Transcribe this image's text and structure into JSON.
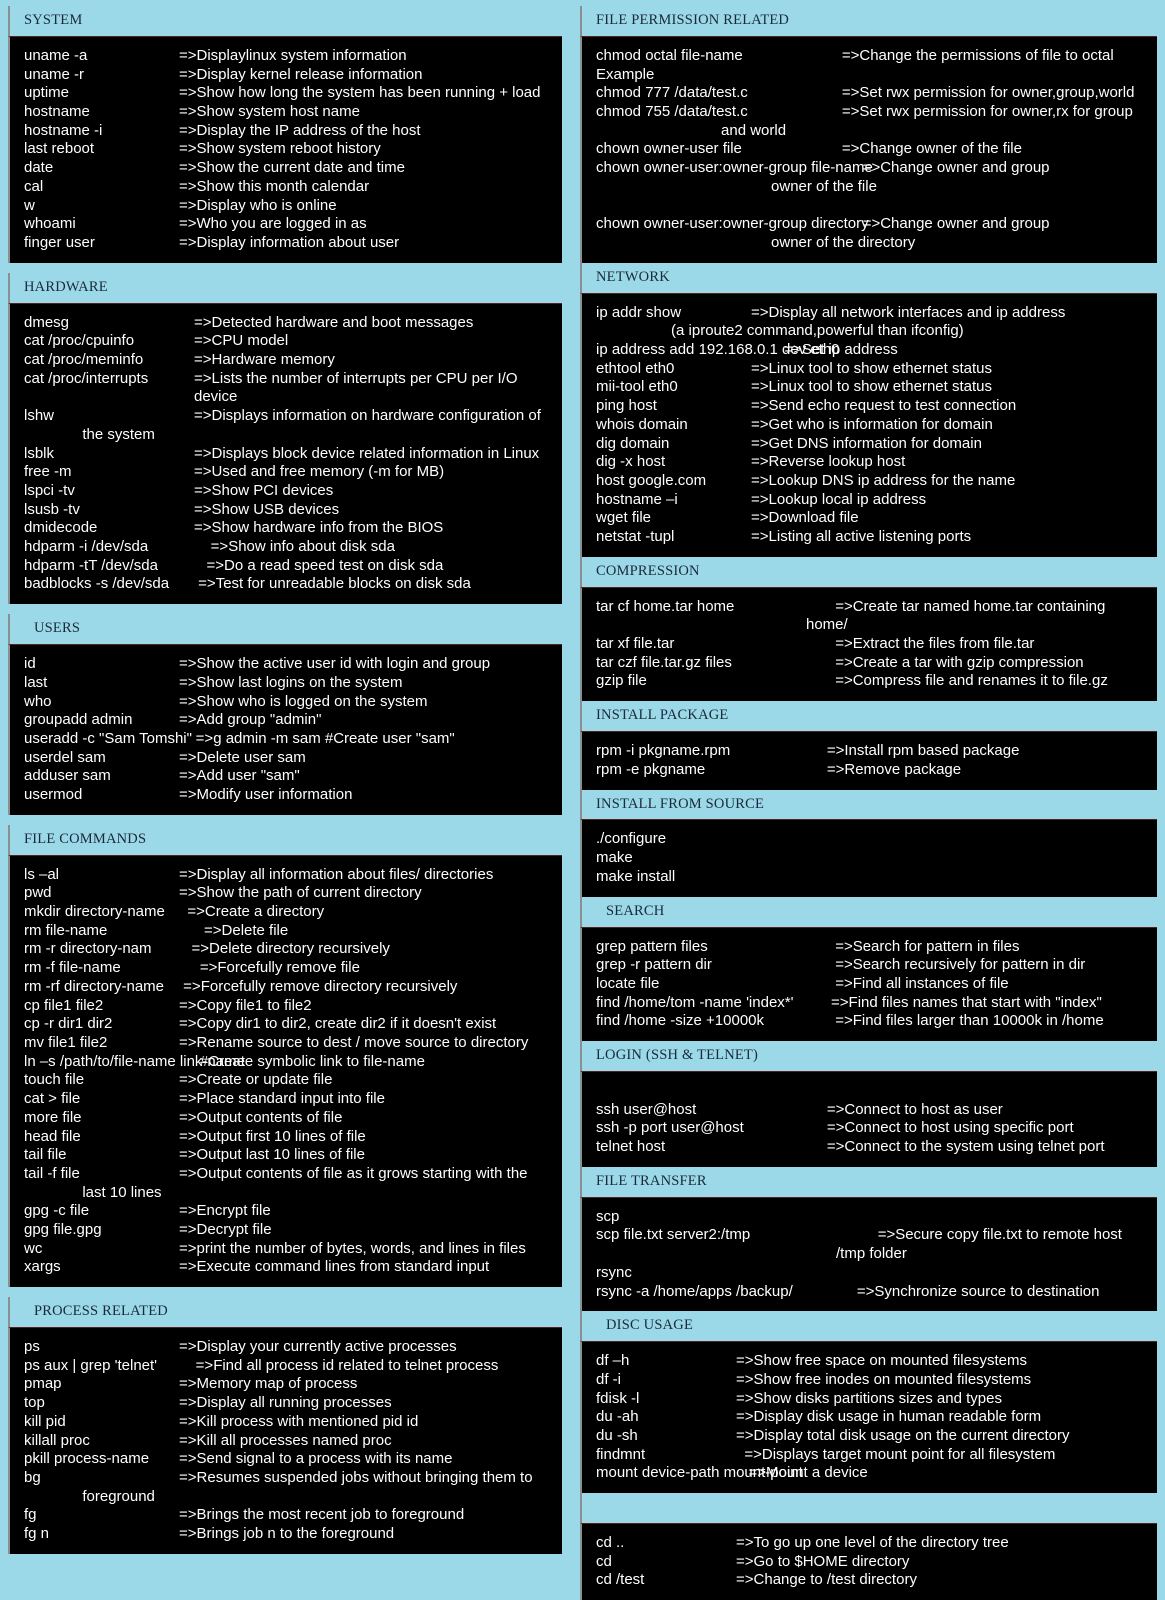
{
  "theme": {
    "background": "#9bd8e8",
    "panel": "#000000",
    "text": "#ffffff",
    "header_text": "#1b2a3a",
    "border": "#8a8f94"
  },
  "left_column": [
    {
      "title": "SYSTEM",
      "rows": [
        {
          "cmd": "uname -a",
          "desc": "=>Displaylinux system information"
        },
        {
          "cmd": "uname -r",
          "desc": "=>Display kernel release information"
        },
        {
          "cmd": "uptime",
          "desc": "=>Show how long the system has been running + load"
        },
        {
          "cmd": "hostname",
          "desc": "=>Show system host name"
        },
        {
          "cmd": "hostname -i",
          "desc": "=>Display the IP address of the host"
        },
        {
          "cmd": "last reboot",
          "desc": "=>Show system reboot history"
        },
        {
          "cmd": "date",
          "desc": "=>Show the current date and time"
        },
        {
          "cmd": "cal",
          "desc": "=>Show this month calendar"
        },
        {
          "cmd": "w",
          "desc": "=>Display who is online"
        },
        {
          "cmd": "whoami",
          "desc": "=>Who you are logged in as"
        },
        {
          "cmd": "finger user",
          "desc": "=>Display information about user"
        }
      ]
    },
    {
      "title": "HARDWARE",
      "rows": [
        {
          "cmd": "dmesg",
          "desc": "=>Detected hardware and boot messages"
        },
        {
          "cmd": "cat /proc/cpuinfo",
          "desc": "=>CPU model"
        },
        {
          "cmd": "cat /proc/meminfo",
          "desc": "=>Hardware memory"
        },
        {
          "cmd": "cat /proc/interrupts",
          "desc": "=>Lists the number of interrupts per CPU per I/O device"
        },
        {
          "cmd": "lshw",
          "desc": "=>Displays information on hardware configuration of"
        },
        {
          "cont": "              the system"
        },
        {
          "cmd": "lsblk",
          "desc": "=>Displays block device related information in Linux"
        },
        {
          "cmd": "free -m",
          "desc": "=>Used and free memory (-m for MB)"
        },
        {
          "cmd": "lspci -tv",
          "desc": "=>Show PCI devices"
        },
        {
          "cmd": "lsusb -tv",
          "desc": "=>Show USB devices"
        },
        {
          "cmd": "dmidecode",
          "desc": "=>Show hardware info from the BIOS"
        },
        {
          "cmd": "hdparm -i /dev/sda",
          "desc": "    =>Show info about disk sda"
        },
        {
          "cmd": "hdparm -tT /dev/sda",
          "desc": "   =>Do a read speed test on disk sda"
        },
        {
          "cmd": "badblocks -s /dev/sda",
          "desc": " =>Test for unreadable blocks on disk sda"
        }
      ]
    },
    {
      "title": "USERS",
      "indent": true,
      "rows": [
        {
          "cmd": "id",
          "desc": "=>Show the active user id with login and group"
        },
        {
          "cmd": "last",
          "desc": "=>Show last logins on the system"
        },
        {
          "cmd": "who",
          "desc": "=>Show who is logged on the system"
        },
        {
          "cmd": "groupadd admin",
          "desc": "=>Add group \"admin\""
        },
        {
          "cmd": "useradd -c \"Sam Tomshi\"",
          "desc": "    =>g admin -m sam #Create user \"sam\""
        },
        {
          "cmd": "userdel sam",
          "desc": "=>Delete user sam"
        },
        {
          "cmd": "adduser sam",
          "desc": "=>Add user \"sam\""
        },
        {
          "cmd": "usermod",
          "desc": "=>Modify user information"
        }
      ]
    },
    {
      "title": "FILE COMMANDS",
      "rows": [
        {
          "cmd": "ls –al",
          "desc": "=>Display all information about files/ directories"
        },
        {
          "cmd": "pwd",
          "desc": "=>Show the path of current directory"
        },
        {
          "cmd": "mkdir directory-name",
          "desc": "  =>Create a directory"
        },
        {
          "cmd": "rm file-name",
          "desc": "      =>Delete file"
        },
        {
          "cmd": "rm -r directory-nam",
          "desc": "   =>Delete directory recursively"
        },
        {
          "cmd": "rm -f file-name",
          "desc": "     =>Forcefully remove file"
        },
        {
          "cmd": "rm -rf directory-name",
          "desc": " =>Forcefully remove directory recursively"
        },
        {
          "cmd": "cp file1 file2",
          "desc": "=>Copy file1 to file2"
        },
        {
          "cmd": "cp -r dir1 dir2",
          "desc": "=>Copy dir1 to dir2, create dir2 if it doesn't exist"
        },
        {
          "cmd": "mv file1 file2",
          "desc": "=>Rename source to dest / move source to directory"
        },
        {
          "cmd": "ln –s /path/to/file-name link-name",
          "desc": "     #Create symbolic link to file-name"
        },
        {
          "cmd": "touch file",
          "desc": "=>Create or update file"
        },
        {
          "cmd": "cat > file",
          "desc": "=>Place standard input into file"
        },
        {
          "cmd": "more file",
          "desc": "=>Output contents of file"
        },
        {
          "cmd": "head file",
          "desc": "=>Output first 10 lines of file"
        },
        {
          "cmd": "tail file",
          "desc": "=>Output last 10 lines of file"
        },
        {
          "cmd": "tail -f file",
          "desc": "=>Output contents of file as it grows starting with the"
        },
        {
          "cont": "              last 10 lines"
        },
        {
          "cmd": "gpg -c file",
          "desc": "=>Encrypt file"
        },
        {
          "cmd": "gpg file.gpg",
          "desc": "=>Decrypt file"
        },
        {
          "cmd": "wc",
          "desc": "=>print the number of bytes, words, and lines in files"
        },
        {
          "cmd": "xargs",
          "desc": "=>Execute command lines from standard input"
        }
      ]
    },
    {
      "title": "PROCESS RELATED",
      "indent": true,
      "rows": [
        {
          "cmd": "ps",
          "desc": "=>Display your currently active processes"
        },
        {
          "cmd": "ps aux | grep 'telnet'",
          "desc": "    =>Find all process id related to telnet process"
        },
        {
          "cmd": "pmap",
          "desc": "=>Memory map of process"
        },
        {
          "cmd": "top",
          "desc": "=>Display all running processes"
        },
        {
          "cmd": "kill pid",
          "desc": "=>Kill process with mentioned pid id"
        },
        {
          "cmd": "killall proc",
          "desc": "=>Kill all processes named proc"
        },
        {
          "cmd": "pkill process-name",
          "desc": "=>Send signal to a process with its name"
        },
        {
          "cmd": "bg",
          "desc": "=>Resumes suspended jobs without bringing them to"
        },
        {
          "cont": "              foreground"
        },
        {
          "cmd": "fg",
          "desc": "=>Brings the most recent job to foreground"
        },
        {
          "cmd": "fg n",
          "desc": "=>Brings job n to the foreground"
        }
      ]
    }
  ],
  "right_column": [
    {
      "title": "FILE PERMISSION RELATED",
      "rows": [
        {
          "cmd": "chmod octal file-name",
          "desc": "     =>Change the permissions of file to octal"
        },
        {
          "cont": "Example"
        },
        {
          "cmd": "chmod 777 /data/test.c",
          "desc": "     =>Set rwx permission for owner,group,world"
        },
        {
          "cmd": "chmod 755 /data/test.c",
          "desc": "     =>Set rwx permission for owner,rx for group"
        },
        {
          "cont": "                              and world"
        },
        {
          "cmd": "chown owner-user file",
          "desc": "     =>Change owner of the file"
        },
        {
          "cmd": "chown owner-user:owner-group file-name",
          "desc": "          =>Change owner and group"
        },
        {
          "cont": "                                          owner of the file"
        },
        {
          "spacer": true
        },
        {
          "cmd": "chown owner-user:owner-group directory",
          "desc": "          =>Change owner and group"
        },
        {
          "cont": "                                          owner of the directory"
        }
      ]
    },
    {
      "title": "NETWORK",
      "rows": [
        {
          "cmd": "ip addr show",
          "desc": "=>Display all network interfaces and ip address"
        },
        {
          "cont": "                  (a iproute2 command,powerful than ifconfig)"
        },
        {
          "cmd": "ip address add 192.168.0.1 dev eth0",
          "desc": "        =>Set ip address"
        },
        {
          "cmd": "ethtool eth0",
          "desc": "=>Linux tool to show ethernet status"
        },
        {
          "cmd": "mii-tool eth0",
          "desc": "=>Linux tool to show ethernet status"
        },
        {
          "cmd": "ping host",
          "desc": "=>Send echo request to test connection"
        },
        {
          "cmd": "whois domain",
          "desc": "=>Get who is information for domain"
        },
        {
          "cmd": "dig domain",
          "desc": "=>Get DNS information for domain"
        },
        {
          "cmd": "dig -x host",
          "desc": "=>Reverse lookup host"
        },
        {
          "cmd": "host google.com",
          "desc": "=>Lookup DNS ip address for the name"
        },
        {
          "cmd": "hostname –i",
          "desc": "=>Lookup local ip address"
        },
        {
          "cmd": "wget file",
          "desc": "=>Download file"
        },
        {
          "cmd": "netstat -tupl",
          "desc": "=>Listing all active listening ports"
        }
      ]
    },
    {
      "title": "COMPRESSION",
      "rows": [
        {
          "cmd": "tar cf home.tar home",
          "desc": "       =>Create tar named home.tar containing home/"
        },
        {
          "cmd": "tar xf file.tar",
          "desc": "       =>Extract the files from file.tar"
        },
        {
          "cmd": "tar czf file.tar.gz files",
          "desc": "       =>Create a tar with gzip compression"
        },
        {
          "cmd": "gzip file",
          "desc": "       =>Compress file and renames it to file.gz"
        }
      ]
    },
    {
      "title": "INSTALL PACKAGE",
      "rows": [
        {
          "cmd": "rpm -i pkgname.rpm",
          "desc": "     =>Install rpm based package"
        },
        {
          "cmd": "rpm -e pkgname",
          "desc": "     =>Remove package"
        }
      ]
    },
    {
      "title": "INSTALL FROM SOURCE",
      "rows": [
        {
          "cont": "./configure"
        },
        {
          "cont": "make"
        },
        {
          "cont": "make install"
        }
      ]
    },
    {
      "title": "SEARCH",
      "indent": true,
      "rows": [
        {
          "cmd": "grep pattern files",
          "desc": "       =>Search for pattern in files"
        },
        {
          "cmd": "grep -r pattern dir",
          "desc": "       =>Search recursively for pattern in dir"
        },
        {
          "cmd": "locate file",
          "desc": "       =>Find all instances of file"
        },
        {
          "cmd": "find /home/tom -name 'index*'",
          "desc": "      =>Find files names that start with \"index\""
        },
        {
          "cmd": "find /home -size +10000k",
          "desc": "       =>Find files larger than 10000k in /home"
        }
      ]
    },
    {
      "title": "LOGIN (SSH & TELNET)",
      "rows": [
        {
          "spacer": true
        },
        {
          "cmd": "ssh user@host",
          "desc": "     =>Connect to host as user"
        },
        {
          "cmd": "ssh -p port user@host",
          "desc": "     =>Connect to host using specific port"
        },
        {
          "cmd": "telnet host",
          "desc": "     =>Connect to the system using telnet port"
        }
      ]
    },
    {
      "title": "FILE TRANSFER",
      "rows": [
        {
          "cont": "scp"
        },
        {
          "cmd": "scp file.txt server2:/tmp",
          "desc": "          =>Secure copy file.txt to remote host /tmp folder"
        },
        {
          "cont": "rsync"
        },
        {
          "cmd": "rsync -a /home/apps /backup/",
          "desc": "     =>Synchronize source to destination"
        }
      ]
    },
    {
      "title": "DISC USAGE",
      "indent": true,
      "rows": [
        {
          "cmd": "df –h",
          "desc": "=>Show free space on mounted filesystems"
        },
        {
          "cmd": "df -i",
          "desc": "=>Show free inodes on mounted filesystems"
        },
        {
          "cmd": "fdisk -l",
          "desc": "=>Show disks partitions sizes and types"
        },
        {
          "cmd": "du -ah",
          "desc": "=>Display disk usage in human readable form"
        },
        {
          "cmd": "du -sh",
          "desc": "=>Display total disk usage on the current directory"
        },
        {
          "cmd": "findmnt",
          "desc": "  =>Displays target mount point for all filesystem"
        },
        {
          "cmd": "mount device-path mount-point",
          "desc": "   =>Mount a device"
        }
      ]
    },
    {
      "title": "",
      "empty": true,
      "rows": [
        {
          "cmd": "cd ..",
          "desc": "=>To go up one level of the directory tree"
        },
        {
          "cmd": "cd",
          "desc": "=>Go to $HOME directory"
        },
        {
          "cmd": "cd /test",
          "desc": "=>Change to /test directory"
        }
      ]
    }
  ]
}
